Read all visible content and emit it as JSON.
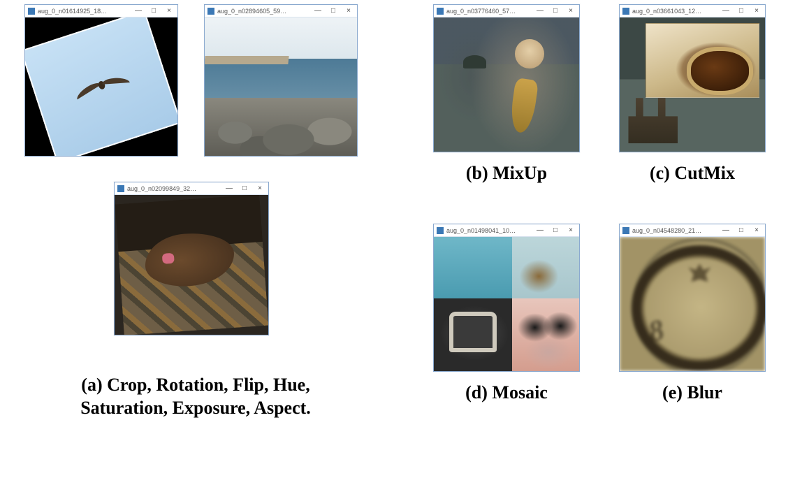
{
  "windows": {
    "a1": {
      "title": "aug_0_n01614925_18…"
    },
    "a2": {
      "title": "aug_0_n02894605_59…"
    },
    "a3": {
      "title": "aug_0_n02099849_32…"
    },
    "b": {
      "title": "aug_0_n03776460_57…"
    },
    "c": {
      "title": "aug_0_n03661043_12…"
    },
    "d": {
      "title": "aug_0_n01498041_10…"
    },
    "e": {
      "title": "aug_0_n04548280_21…"
    }
  },
  "window_controls": {
    "minimize": "—",
    "maximize": "□",
    "close": "×"
  },
  "captions": {
    "a_line1": "(a)  Crop, Rotation, Flip, Hue,",
    "a_line2": "Saturation, Exposure, Aspect.",
    "b": "(b) MixUp",
    "c": "(c) CutMix",
    "d": "(d) Mosaic",
    "e": "(e) Blur"
  },
  "blur_numeral": "8"
}
